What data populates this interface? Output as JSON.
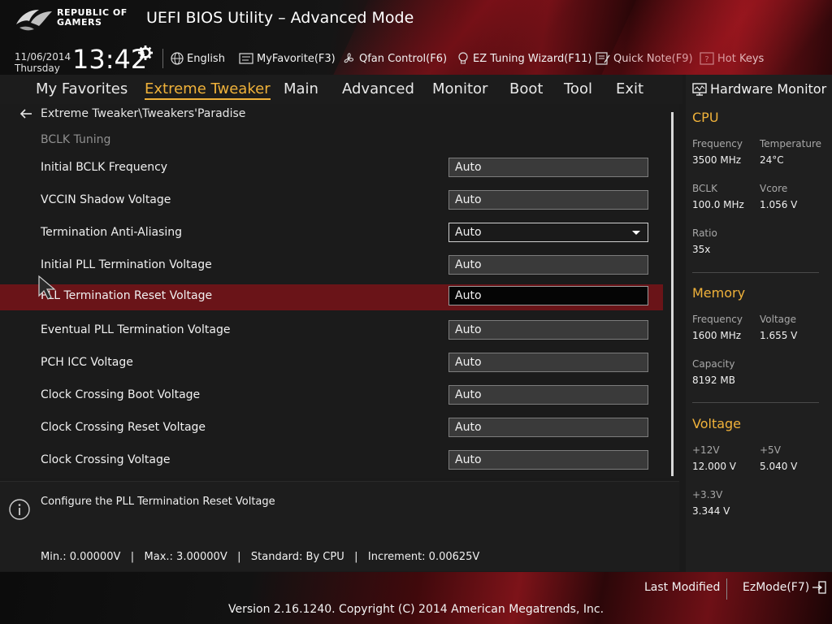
{
  "header": {
    "brand_line1": "REPUBLIC OF",
    "brand_line2": "GAMERS",
    "title": "UEFI BIOS Utility – Advanced Mode",
    "date": "11/06/2014",
    "day": "Thursday",
    "time": "13:42",
    "toolbar": {
      "language": "English",
      "favorite": "MyFavorite(F3)",
      "qfan": "Qfan Control(F6)",
      "ez_tuning": "EZ Tuning Wizard(F11)",
      "quick_note": "Quick Note(F9)",
      "hot_keys": "Hot Keys"
    }
  },
  "nav": {
    "tabs": [
      {
        "label": "My Favorites"
      },
      {
        "label": "Extreme Tweaker",
        "active": true
      },
      {
        "label": "Main"
      },
      {
        "label": "Advanced"
      },
      {
        "label": "Monitor"
      },
      {
        "label": "Boot"
      },
      {
        "label": "Tool"
      },
      {
        "label": "Exit"
      }
    ]
  },
  "main": {
    "breadcrumb": "Extreme Tweaker\\Tweakers'Paradise",
    "section": "BCLK Tuning",
    "settings": [
      {
        "label": "Initial BCLK Frequency",
        "value": "Auto"
      },
      {
        "label": "VCCIN Shadow Voltage",
        "value": "Auto"
      },
      {
        "label": "Termination Anti-Aliasing",
        "value": "Auto",
        "dropdown": true
      },
      {
        "label": "Initial PLL Termination Voltage",
        "value": "Auto"
      },
      {
        "label": "PLL Termination Reset Voltage",
        "value": "Auto",
        "selected": true
      },
      {
        "label": "Eventual PLL Termination Voltage",
        "value": "Auto"
      },
      {
        "label": "PCH ICC Voltage",
        "value": "Auto"
      },
      {
        "label": "Clock Crossing Boot Voltage",
        "value": "Auto"
      },
      {
        "label": "Clock Crossing Reset Voltage",
        "value": "Auto"
      },
      {
        "label": "Clock Crossing Voltage",
        "value": "Auto"
      }
    ]
  },
  "help": {
    "description": "Configure the PLL Termination Reset Voltage",
    "specs": "Min.: 0.00000V   |   Max.: 3.00000V   |   Standard: By CPU   |   Increment: 0.00625V"
  },
  "hardware_monitor": {
    "title": "Hardware Monitor",
    "cpu": {
      "heading": "CPU",
      "frequency_label": "Frequency",
      "frequency": "3500 MHz",
      "temperature_label": "Temperature",
      "temperature": "24°C",
      "bclk_label": "BCLK",
      "bclk": "100.0 MHz",
      "vcore_label": "Vcore",
      "vcore": "1.056 V",
      "ratio_label": "Ratio",
      "ratio": "35x"
    },
    "memory": {
      "heading": "Memory",
      "frequency_label": "Frequency",
      "frequency": "1600 MHz",
      "voltage_label": "Voltage",
      "voltage": "1.655 V",
      "capacity_label": "Capacity",
      "capacity": "8192 MB"
    },
    "voltage": {
      "heading": "Voltage",
      "v12_label": "+12V",
      "v12": "12.000 V",
      "v5_label": "+5V",
      "v5": "5.040 V",
      "v33_label": "+3.3V",
      "v33": "3.344 V"
    }
  },
  "footer": {
    "last_modified": "Last Modified",
    "ez_mode": "EzMode(F7)",
    "version": "Version 2.16.1240. Copyright (C) 2014 American Megatrends, Inc."
  },
  "colors": {
    "accent": "#f0b23a",
    "selected_row": "#6a1418",
    "brand_red": "#7d1319"
  }
}
